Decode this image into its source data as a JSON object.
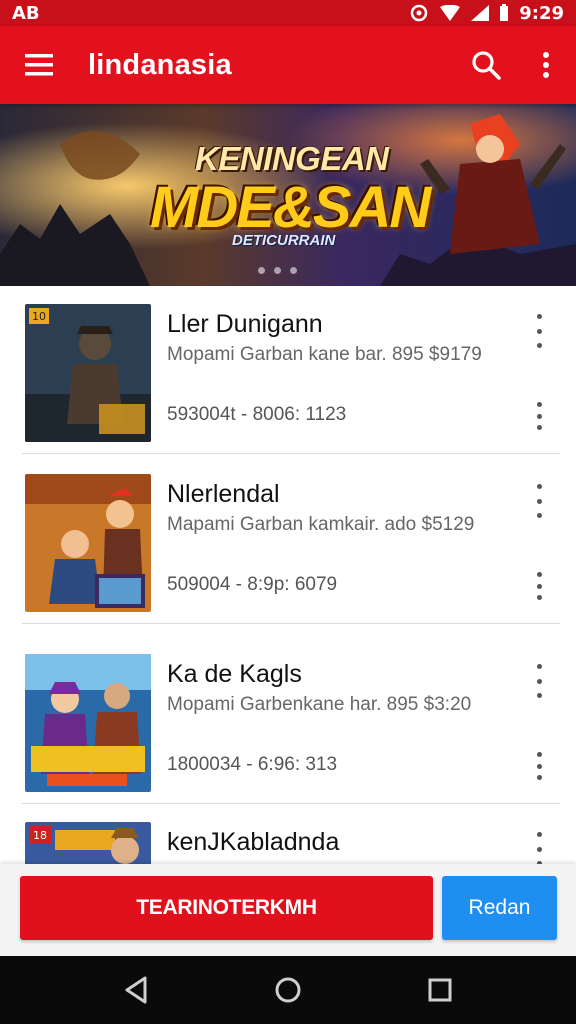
{
  "status_bar": {
    "carrier": "AB",
    "time": "9:29"
  },
  "app_bar": {
    "title": "lindanasia",
    "icons": [
      "menu-icon",
      "search-icon",
      "more-vert-icon"
    ]
  },
  "banner": {
    "line1": "KENINGEAN",
    "line2": "MDE&SAN",
    "line3": "DETICURRAIN",
    "pages": 3,
    "active_page": 0
  },
  "games": [
    {
      "name": "Ller Dunigann",
      "description": "Mopami Garban kane bar. 895 $9179",
      "meta": "593004t - 8006: 1123",
      "badge": "10"
    },
    {
      "name": "Nlerlendal",
      "description": "Mapami Garban kamkair. ado $5129",
      "meta": "509004 - 8:9p: 6079",
      "badge": ""
    },
    {
      "name": "Ka de Kagls",
      "description": "Mopami Garbenkane har. 895 $3:20",
      "meta": "1800034 - 6:96: 313",
      "badge": ""
    },
    {
      "name": "kenJKabladnda",
      "description": "",
      "meta": "",
      "badge": "18"
    }
  ],
  "actions": {
    "primary_label": "TEARINOTERKMH",
    "secondary_label": "Redan"
  },
  "colors": {
    "brand_red": "#e3101d",
    "accent_blue": "#1e8ff0"
  }
}
